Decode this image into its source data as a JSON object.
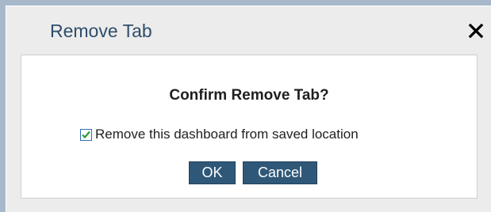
{
  "dialog": {
    "title": "Remove Tab",
    "close_icon": "close-icon",
    "heading": "Confirm Remove Tab?",
    "checkbox": {
      "label": "Remove this dashboard from saved location",
      "checked": true
    },
    "buttons": {
      "ok_label": "OK",
      "cancel_label": "Cancel"
    }
  },
  "colors": {
    "title_text": "#2f4d6b",
    "button_bg": "#2f5878",
    "checkbox_check": "#2c9a3a",
    "page_bg": "#a7b8cb"
  }
}
